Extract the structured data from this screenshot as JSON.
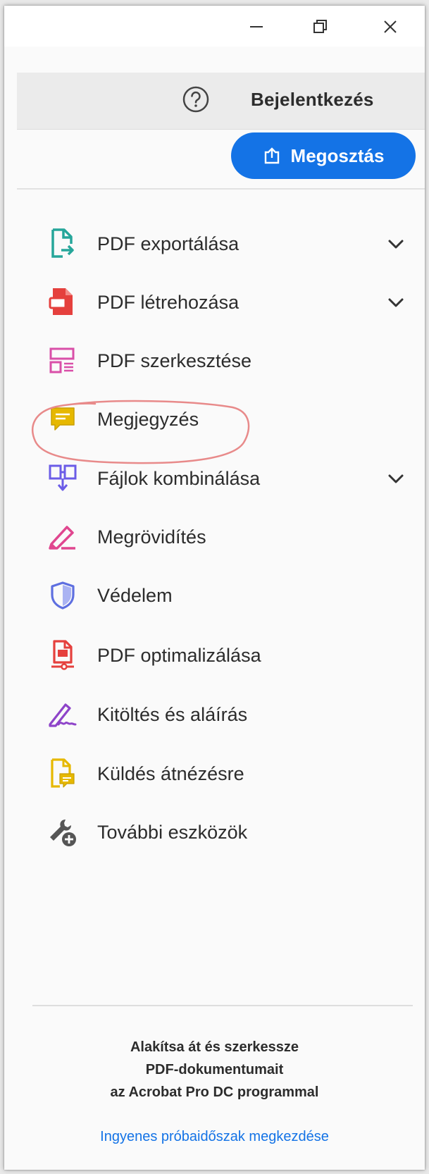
{
  "window": {
    "controls": [
      "minimize-icon",
      "restore-icon",
      "close-icon"
    ]
  },
  "header": {
    "help_icon": "help-circle-icon",
    "signin_label": "Bejelentkezés"
  },
  "share": {
    "label": "Megosztás",
    "icon": "share-upload-icon",
    "color": "#1473e6"
  },
  "tools": [
    {
      "label": "PDF exportálása",
      "icon": "export-pdf-icon",
      "has_chevron": true,
      "color": "#26a69a"
    },
    {
      "label": "PDF létrehozása",
      "icon": "create-pdf-icon",
      "has_chevron": true,
      "color": "#e5403d"
    },
    {
      "label": "PDF szerkesztése",
      "icon": "edit-pdf-icon",
      "has_chevron": false,
      "color": "#d94fa8"
    },
    {
      "label": "Megjegyzés",
      "icon": "comment-icon",
      "has_chevron": false,
      "color": "#e6b800"
    },
    {
      "label": "Fájlok kombinálása",
      "icon": "combine-files-icon",
      "has_chevron": true,
      "color": "#6b5ce7"
    },
    {
      "label": "Megrövidítés",
      "icon": "redact-icon",
      "has_chevron": false,
      "color": "#e0468f"
    },
    {
      "label": "Védelem",
      "icon": "shield-icon",
      "has_chevron": false,
      "color": "#5e6fe0"
    },
    {
      "label": "PDF optimalizálása",
      "icon": "optimize-pdf-icon",
      "has_chevron": false,
      "color": "#e5403d"
    },
    {
      "label": "Kitöltés és aláírás",
      "icon": "fill-sign-icon",
      "has_chevron": false,
      "color": "#8e44c9"
    },
    {
      "label": "Küldés átnézésre",
      "icon": "send-review-icon",
      "has_chevron": false,
      "color": "#e6b800"
    },
    {
      "label": "További eszközök",
      "icon": "more-tools-icon",
      "has_chevron": false,
      "color": "#555555"
    }
  ],
  "promo": {
    "line1": "Alakítsa át és szerkessze",
    "line2": "PDF-dokumentumait",
    "line3": "az Acrobat Pro DC programmal",
    "link": "Ingyenes próbaidőszak megkezdése"
  },
  "annotation_color": "#e88a8a"
}
